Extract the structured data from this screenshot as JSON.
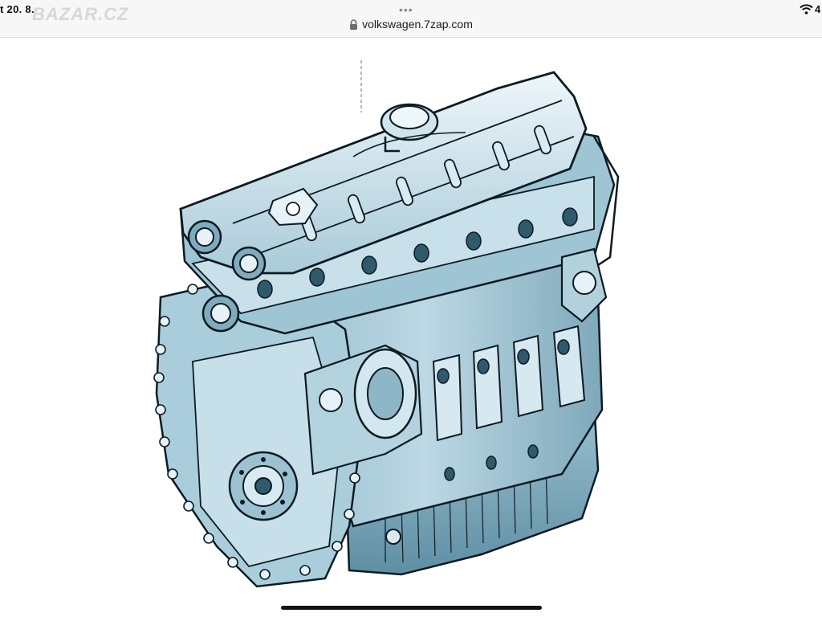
{
  "status_bar": {
    "time": "t 20. 8.",
    "battery": "4",
    "wifi_icon": "wifi-icon"
  },
  "watermark": {
    "text": "BAZAR.CZ"
  },
  "browser": {
    "menu_dots": "•••",
    "url": "volkswagen.7zap.com",
    "lock_icon": "lock-icon"
  },
  "content": {
    "image_subject": "engine-illustration",
    "colors": {
      "engine_fill": "#b9d6e2",
      "engine_light": "#e2eff5",
      "engine_shadow": "#6f9fb2",
      "outline": "#0e1a22"
    }
  }
}
